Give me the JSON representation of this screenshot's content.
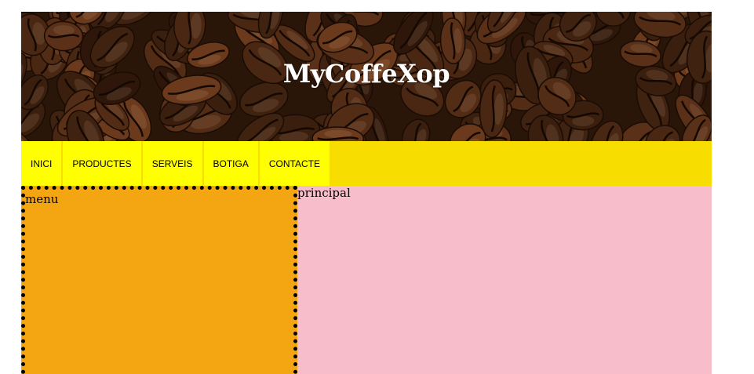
{
  "header": {
    "title": "MyCoffeXop",
    "background_image": "coffee-beans-photo"
  },
  "nav": {
    "items": [
      {
        "label": "INICI"
      },
      {
        "label": "PRODUCTES"
      },
      {
        "label": "SERVEIS"
      },
      {
        "label": "BOTIGA"
      },
      {
        "label": "CONTACTE"
      }
    ]
  },
  "aside": {
    "text": "menu"
  },
  "main": {
    "text": "principal"
  },
  "colors": {
    "nav_bar": "#f8dd00",
    "nav_item": "#ffff00",
    "aside_bg": "#f4a512",
    "main_bg": "#f8bdca"
  }
}
